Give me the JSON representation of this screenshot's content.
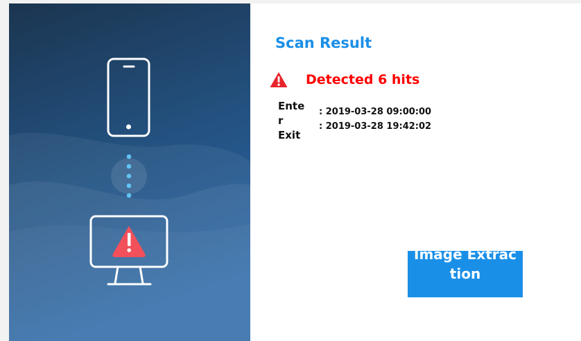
{
  "dialog": {
    "title": "Scan Result",
    "alert": {
      "icon": "warning-triangle-icon",
      "text": "Detected 6 hits"
    },
    "times": {
      "enter_label": "Enter",
      "enter_value": ": 2019-03-28 09:00:00",
      "exit_label": "Exit",
      "exit_value": ": 2019-03-28 19:42:02"
    },
    "extract_button_label": "Image Extraction"
  },
  "illustration": {
    "top_icon": "smartphone-icon",
    "middle_icon": "dotted-connector-icon",
    "bottom_icon": "monitor-warning-icon"
  },
  "colors": {
    "accent": "#1a8fe8",
    "danger": "#ff0000",
    "panel_gradient_top": "#1b3550",
    "panel_gradient_bottom": "#2a67a6"
  }
}
